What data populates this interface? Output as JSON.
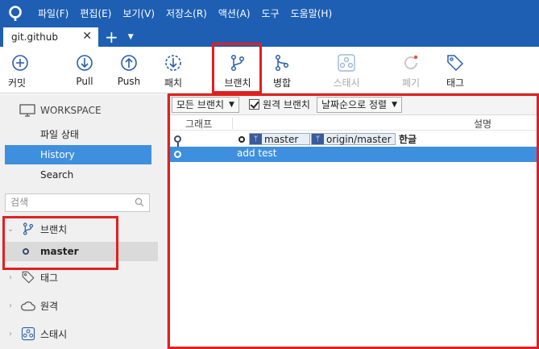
{
  "menu": [
    "파일(F)",
    "편집(E)",
    "보기(V)",
    "저장소(R)",
    "액션(A)",
    "도구",
    "도움말(H)"
  ],
  "tab": {
    "title": "git.github",
    "close": "✕",
    "add": "+",
    "menu": "▼"
  },
  "toolbar": {
    "commit": "커밋",
    "pull": "Pull",
    "push": "Push",
    "fetch": "패치",
    "branch": "브랜치",
    "merge": "병합",
    "stash": "스태시",
    "discard": "폐기",
    "tag": "태그"
  },
  "sidebar": {
    "workspace": "WORKSPACE",
    "file_status": "파일 상태",
    "history": "History",
    "search": "Search",
    "search_placeholder": "검색",
    "branches": "브랜치",
    "branch_master": "master",
    "tags": "태그",
    "remotes": "원격",
    "stashes": "스태시"
  },
  "filter": {
    "all_branches": "모든 브랜치",
    "remote_branches": "원격 브랜치",
    "remote_checked": true,
    "sort": "날짜순으로 정렬"
  },
  "columns": {
    "graph": "그래프",
    "description": "설명"
  },
  "commits": [
    {
      "refs": [
        "master",
        "origin/master"
      ],
      "message": "한글"
    },
    {
      "refs": [],
      "message": "add test"
    }
  ],
  "colors": {
    "accent": "#1e5fb4",
    "selection": "#3f8fdf",
    "highlight": "#e02020"
  }
}
